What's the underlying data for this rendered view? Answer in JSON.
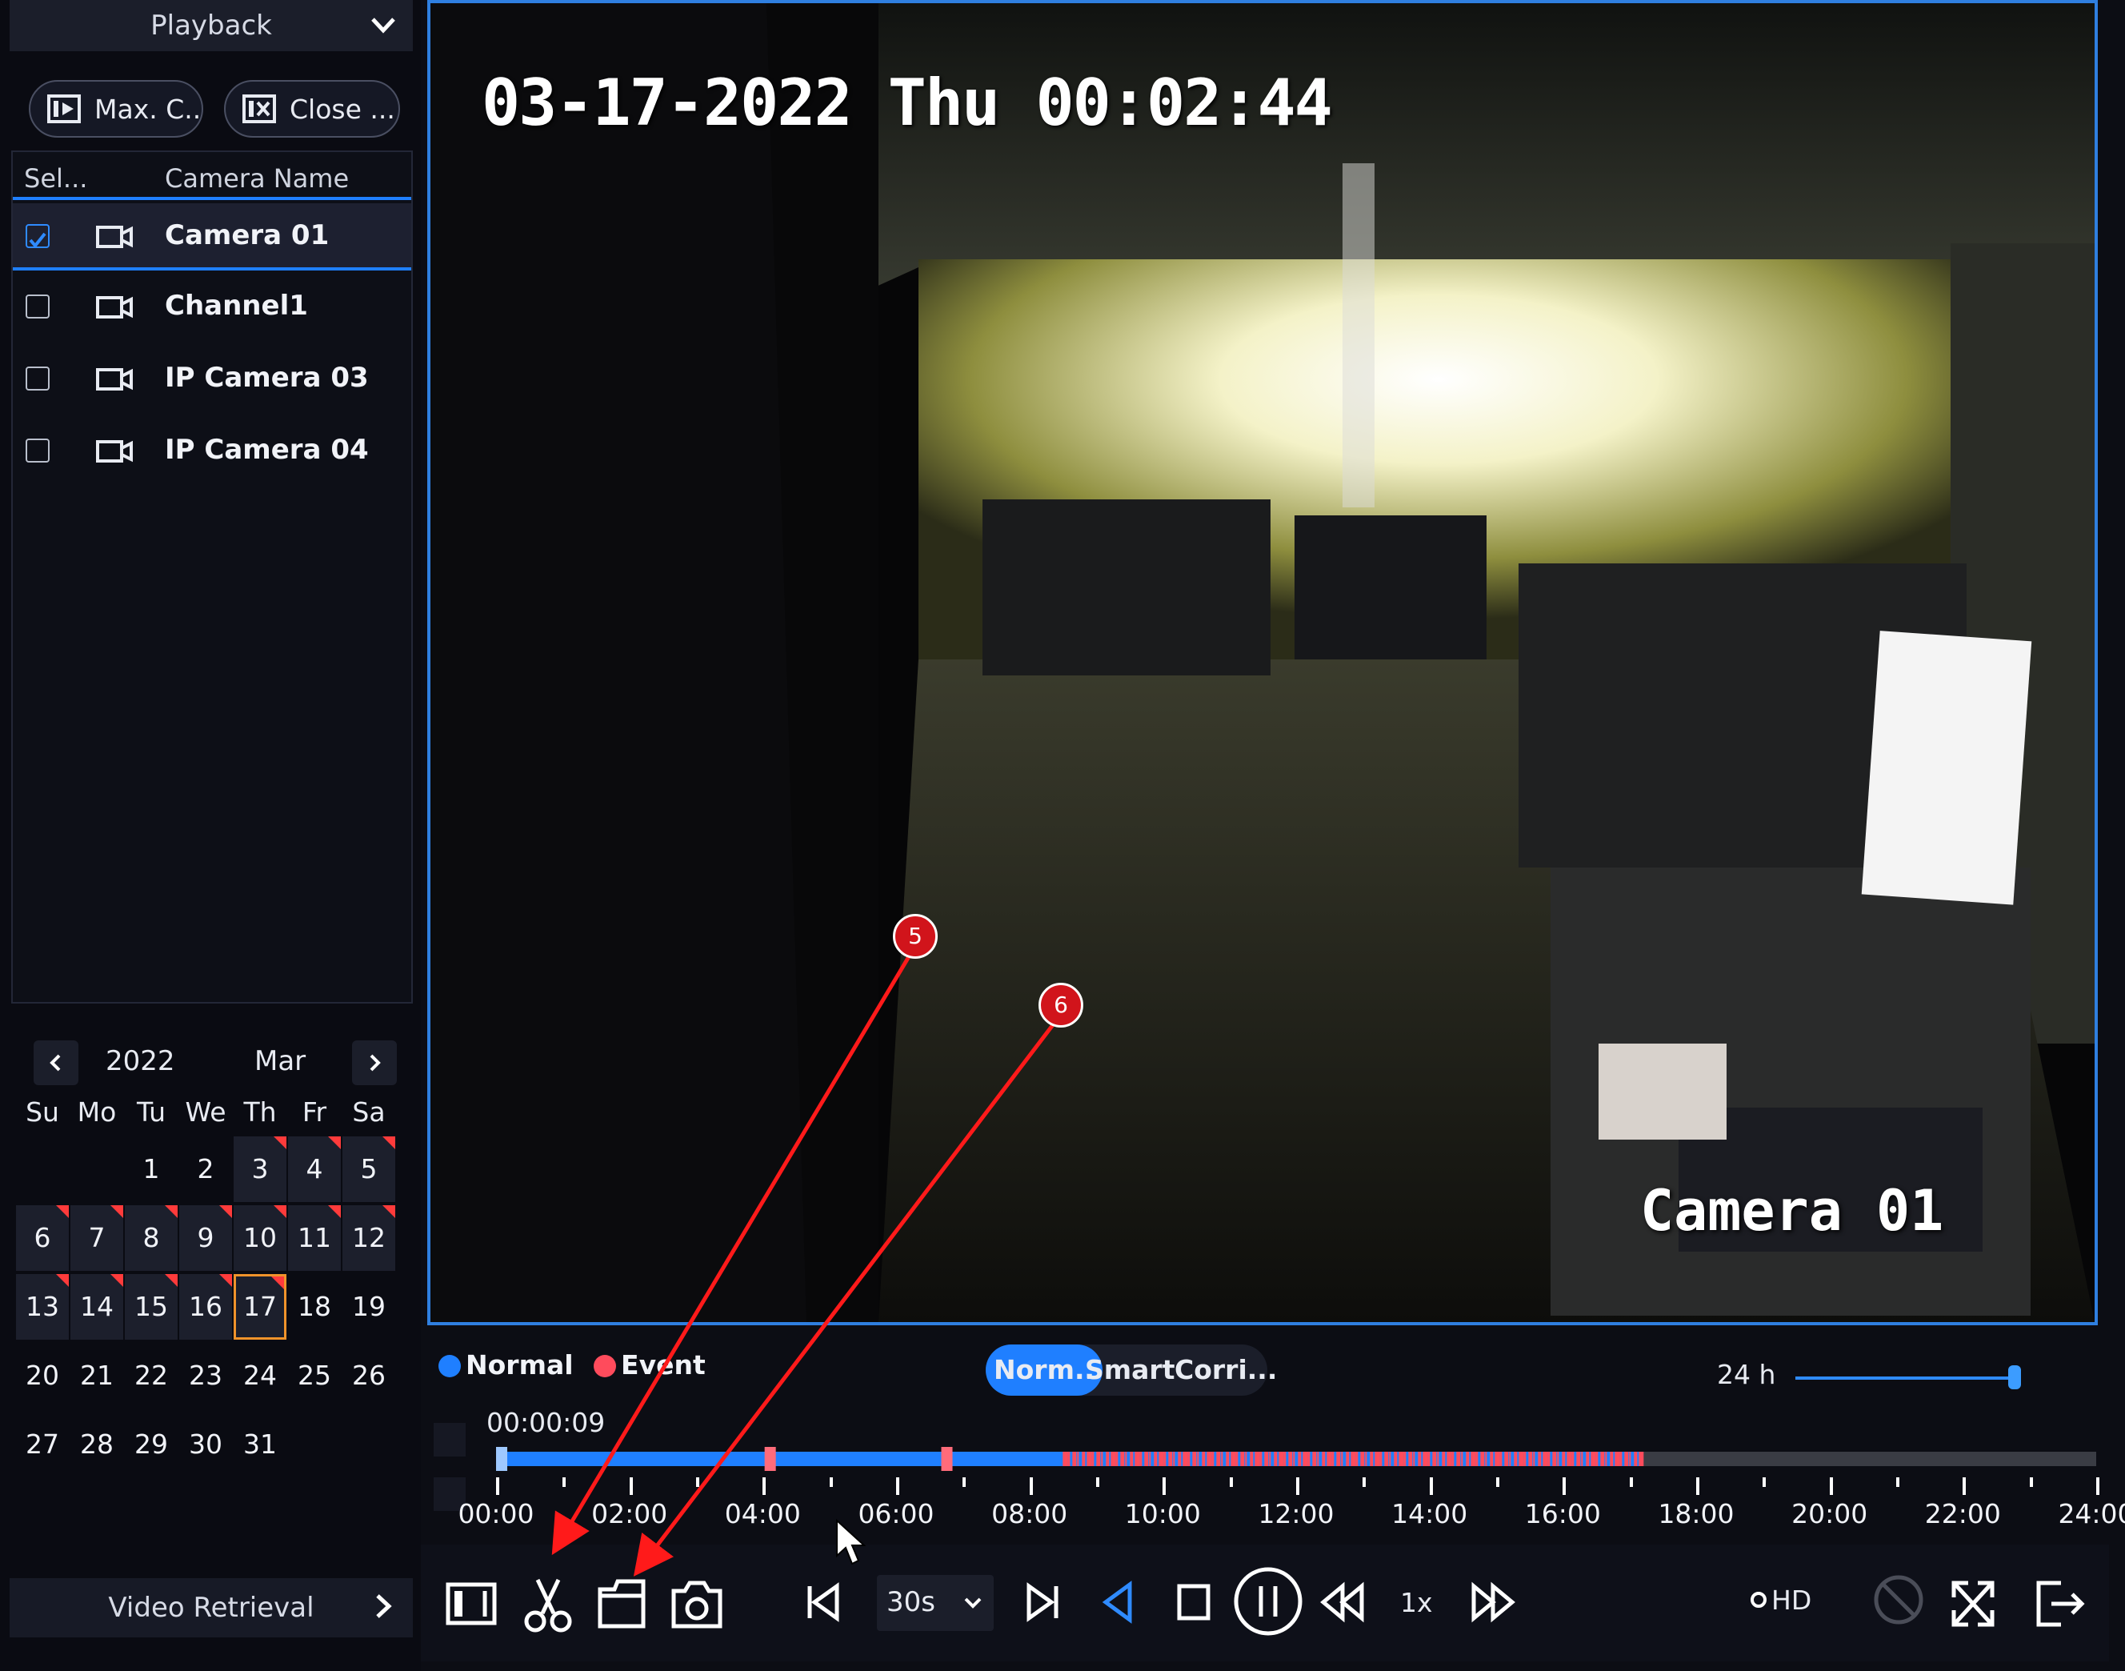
{
  "sidebar": {
    "header_label": "Playback",
    "max_button": "Max. C..",
    "close_button": "Close ...",
    "columns": {
      "select": "Sel...",
      "name": "Camera Name"
    },
    "cameras": [
      {
        "name": "Camera 01",
        "checked": true
      },
      {
        "name": "Channel1",
        "checked": false
      },
      {
        "name": "IP Camera 03",
        "checked": false
      },
      {
        "name": "IP Camera 04",
        "checked": false
      }
    ],
    "retrieval_label": "Video Retrieval"
  },
  "calendar": {
    "year": "2022",
    "month": "Mar",
    "weekdays": [
      "Su",
      "Mo",
      "Tu",
      "We",
      "Th",
      "Fr",
      "Sa"
    ],
    "first_weekday_index": 2,
    "days_in_month": 31,
    "selected_day": 17,
    "days_with_records": [
      3,
      4,
      5,
      6,
      7,
      8,
      9,
      10,
      11,
      12,
      13,
      14,
      15,
      16,
      17
    ],
    "record_marker_color": "#ff3b3b"
  },
  "video": {
    "osd_timestamp": "03-17-2022 Thu 00:02:44",
    "osd_camera_name": "Camera 01"
  },
  "timeline": {
    "legend_normal": "Normal",
    "legend_event": "Event",
    "normal_color": "#1f7fff",
    "event_color": "#ff4b5c",
    "modes": [
      "Norm..",
      "Smart",
      "Corri..."
    ],
    "active_mode": "Norm..",
    "span_label": "24 h",
    "current_time": "00:00:09",
    "hour_labels": [
      "00:00",
      "02:00",
      "04:00",
      "06:00",
      "08:00",
      "10:00",
      "12:00",
      "14:00",
      "16:00",
      "18:00",
      "20:00",
      "22:00",
      "24:00"
    ],
    "recorded_until_hour": 17.2,
    "event_dense_from_hour": 8.5,
    "event_markers_hours": [
      4.1,
      6.75
    ]
  },
  "toolbar": {
    "interval_value": "30s",
    "rate_label": "1x",
    "quality_label": "HD"
  },
  "annotations": [
    {
      "number": "5"
    },
    {
      "number": "6"
    }
  ]
}
